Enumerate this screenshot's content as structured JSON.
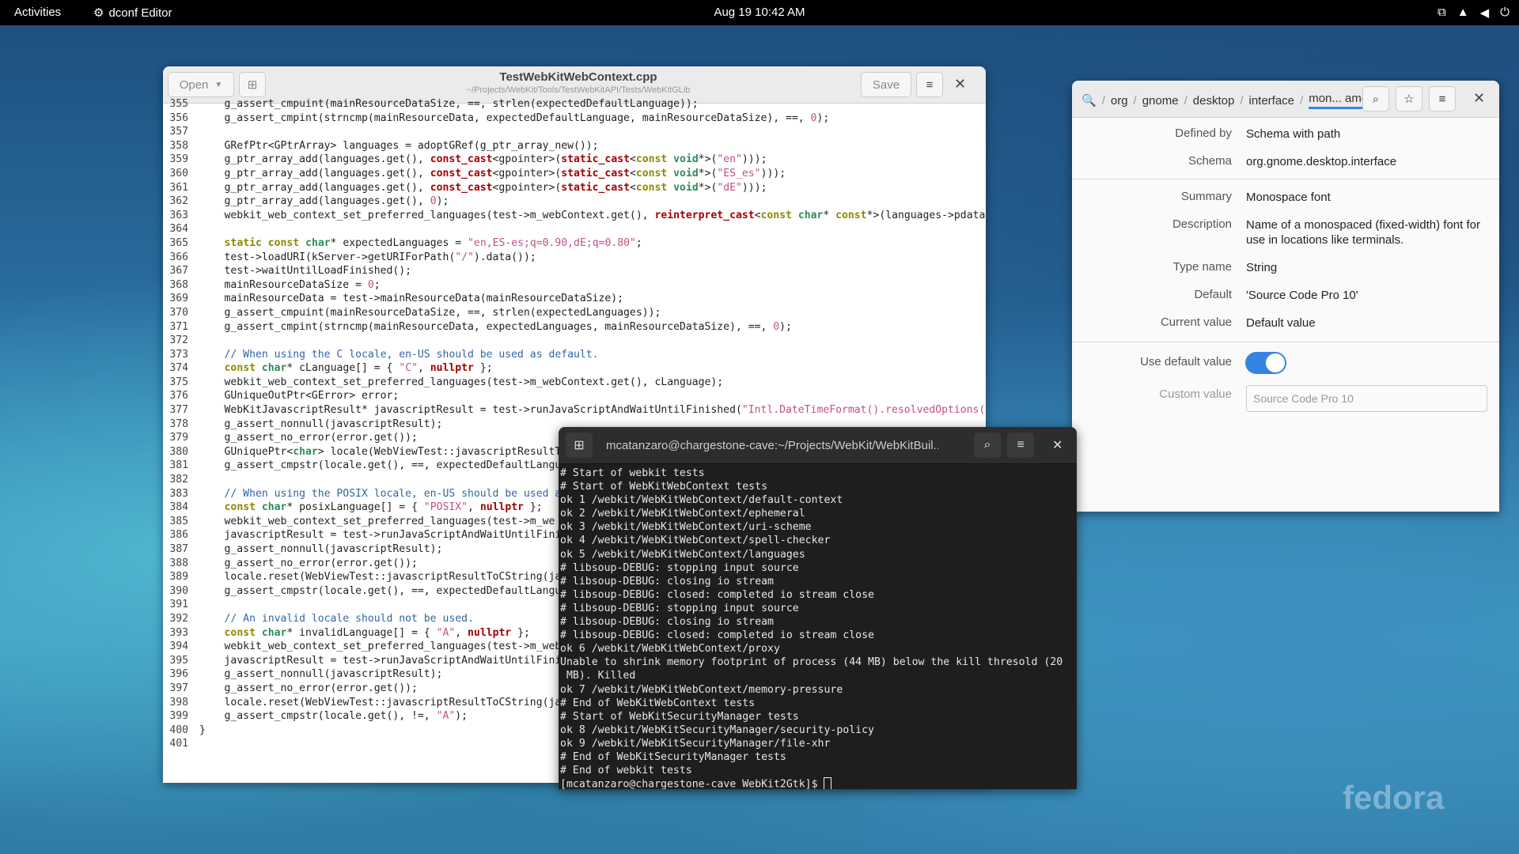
{
  "topbar": {
    "activities": "Activities",
    "app_name": "dconf Editor",
    "clock": "Aug 19  10:42 AM"
  },
  "gedit": {
    "open_label": "Open",
    "title": "TestWebKitWebContext.cpp",
    "path": "~/Projects/WebKit/Tools/TestWebKitAPI/Tests/WebKitGLib",
    "save_label": "Save"
  },
  "code_lines": [
    {
      "n": "355",
      "t": "    g_assert_cmpuint(mainResourceDataSize, ==, strlen(expectedDefaultLanguage));"
    },
    {
      "n": "356",
      "t": "    g_assert_cmpint(strncmp(mainResourceData, expectedDefaultLanguage, mainResourceDataSize), ==, 0);"
    },
    {
      "n": "357",
      "t": ""
    },
    {
      "n": "358",
      "t": "    GRefPtr<GPtrArray> languages = adoptGRef(g_ptr_array_new());"
    },
    {
      "n": "359",
      "t": "    g_ptr_array_add(languages.get(), const_cast<gpointer>(static_cast<const void*>(\"en\")));"
    },
    {
      "n": "360",
      "t": "    g_ptr_array_add(languages.get(), const_cast<gpointer>(static_cast<const void*>(\"ES_es\")));"
    },
    {
      "n": "361",
      "t": "    g_ptr_array_add(languages.get(), const_cast<gpointer>(static_cast<const void*>(\"dE\")));"
    },
    {
      "n": "362",
      "t": "    g_ptr_array_add(languages.get(), 0);"
    },
    {
      "n": "363",
      "t": "    webkit_web_context_set_preferred_languages(test->m_webContext.get(), reinterpret_cast<const char* const*>(languages->pdata"
    },
    {
      "n": "364",
      "t": ""
    },
    {
      "n": "365",
      "t": "    static const char* expectedLanguages = \"en,ES-es;q=0.90,dE;q=0.80\";"
    },
    {
      "n": "366",
      "t": "    test->loadURI(kServer->getURIForPath(\"/\").data());"
    },
    {
      "n": "367",
      "t": "    test->waitUntilLoadFinished();"
    },
    {
      "n": "368",
      "t": "    mainResourceDataSize = 0;"
    },
    {
      "n": "369",
      "t": "    mainResourceData = test->mainResourceData(mainResourceDataSize);"
    },
    {
      "n": "370",
      "t": "    g_assert_cmpuint(mainResourceDataSize, ==, strlen(expectedLanguages));"
    },
    {
      "n": "371",
      "t": "    g_assert_cmpint(strncmp(mainResourceData, expectedLanguages, mainResourceDataSize), ==, 0);"
    },
    {
      "n": "372",
      "t": ""
    },
    {
      "n": "373",
      "t": "    // When using the C locale, en-US should be used as default."
    },
    {
      "n": "374",
      "t": "    const char* cLanguage[] = { \"C\", nullptr };"
    },
    {
      "n": "375",
      "t": "    webkit_web_context_set_preferred_languages(test->m_webContext.get(), cLanguage);"
    },
    {
      "n": "376",
      "t": "    GUniqueOutPtr<GError> error;"
    },
    {
      "n": "377",
      "t": "    WebKitJavascriptResult* javascriptResult = test->runJavaScriptAndWaitUntilFinished(\"Intl.DateTimeFormat().resolvedOptions("
    },
    {
      "n": "378",
      "t": "    g_assert_nonnull(javascriptResult);"
    },
    {
      "n": "379",
      "t": "    g_assert_no_error(error.get());"
    },
    {
      "n": "380",
      "t": "    GUniquePtr<char> locale(WebViewTest::javascriptResultTo"
    },
    {
      "n": "381",
      "t": "    g_assert_cmpstr(locale.get(), ==, expectedDefaultLangu"
    },
    {
      "n": "382",
      "t": ""
    },
    {
      "n": "383",
      "t": "    // When using the POSIX locale, en-US should be used a"
    },
    {
      "n": "384",
      "t": "    const char* posixLanguage[] = { \"POSIX\", nullptr };"
    },
    {
      "n": "385",
      "t": "    webkit_web_context_set_preferred_languages(test->m_we"
    },
    {
      "n": "386",
      "t": "    javascriptResult = test->runJavaScriptAndWaitUntilFini"
    },
    {
      "n": "387",
      "t": "    g_assert_nonnull(javascriptResult);"
    },
    {
      "n": "388",
      "t": "    g_assert_no_error(error.get());"
    },
    {
      "n": "389",
      "t": "    locale.reset(WebViewTest::javascriptResultToCString(ja"
    },
    {
      "n": "390",
      "t": "    g_assert_cmpstr(locale.get(), ==, expectedDefaultLangu"
    },
    {
      "n": "391",
      "t": ""
    },
    {
      "n": "392",
      "t": "    // An invalid locale should not be used."
    },
    {
      "n": "393",
      "t": "    const char* invalidLanguage[] = { \"A\", nullptr };"
    },
    {
      "n": "394",
      "t": "    webkit_web_context_set_preferred_languages(test->m_web"
    },
    {
      "n": "395",
      "t": "    javascriptResult = test->runJavaScriptAndWaitUntilFini"
    },
    {
      "n": "396",
      "t": "    g_assert_nonnull(javascriptResult);"
    },
    {
      "n": "397",
      "t": "    g_assert_no_error(error.get());"
    },
    {
      "n": "398",
      "t": "    locale.reset(WebViewTest::javascriptResultToCString(ja"
    },
    {
      "n": "399",
      "t": "    g_assert_cmpstr(locale.get(), !=, \"A\");"
    },
    {
      "n": "400",
      "t": "}"
    },
    {
      "n": "401",
      "t": ""
    }
  ],
  "dconf": {
    "breadcrumbs": [
      "org",
      "gnome",
      "desktop",
      "interface"
    ],
    "current_key": "mon... ame",
    "defined_by_label": "Defined by",
    "defined_by": "Schema with path",
    "schema_label": "Schema",
    "schema": "org.gnome.desktop.interface",
    "summary_label": "Summary",
    "summary": "Monospace font",
    "description_label": "Description",
    "description": "Name of a monospaced (fixed-width) font for use in locations like terminals.",
    "type_label": "Type name",
    "type": "String",
    "default_label": "Default",
    "default": "'Source Code Pro 10'",
    "current_label": "Current value",
    "current": "Default value",
    "use_default_label": "Use default value",
    "use_default_on": true,
    "custom_label": "Custom value",
    "custom_placeholder": "Source Code Pro 10"
  },
  "terminal": {
    "title": "mcatanzaro@chargestone-cave:~/Projects/WebKit/WebKitBuil...",
    "lines": [
      "# Start of webkit tests",
      "# Start of WebKitWebContext tests",
      "ok 1 /webkit/WebKitWebContext/default-context",
      "ok 2 /webkit/WebKitWebContext/ephemeral",
      "ok 3 /webkit/WebKitWebContext/uri-scheme",
      "ok 4 /webkit/WebKitWebContext/spell-checker",
      "ok 5 /webkit/WebKitWebContext/languages",
      "# libsoup-DEBUG: stopping input source",
      "# libsoup-DEBUG: closing io stream",
      "# libsoup-DEBUG: closed: completed io stream close",
      "# libsoup-DEBUG: stopping input source",
      "# libsoup-DEBUG: closing io stream",
      "# libsoup-DEBUG: closed: completed io stream close",
      "ok 6 /webkit/WebKitWebContext/proxy",
      "Unable to shrink memory footprint of process (44 MB) below the kill thresold (20",
      " MB). Killed",
      "ok 7 /webkit/WebKitWebContext/memory-pressure",
      "# End of WebKitWebContext tests",
      "# Start of WebKitSecurityManager tests",
      "ok 8 /webkit/WebKitSecurityManager/security-policy",
      "ok 9 /webkit/WebKitSecurityManager/file-xhr",
      "# End of WebKitSecurityManager tests",
      "# End of webkit tests"
    ],
    "prompt": "[mcatanzaro@chargestone-cave WebKit2Gtk]$ "
  },
  "wallpaper": {
    "logo_text": "fedora"
  },
  "colors": {
    "accent": "#3584e4"
  }
}
